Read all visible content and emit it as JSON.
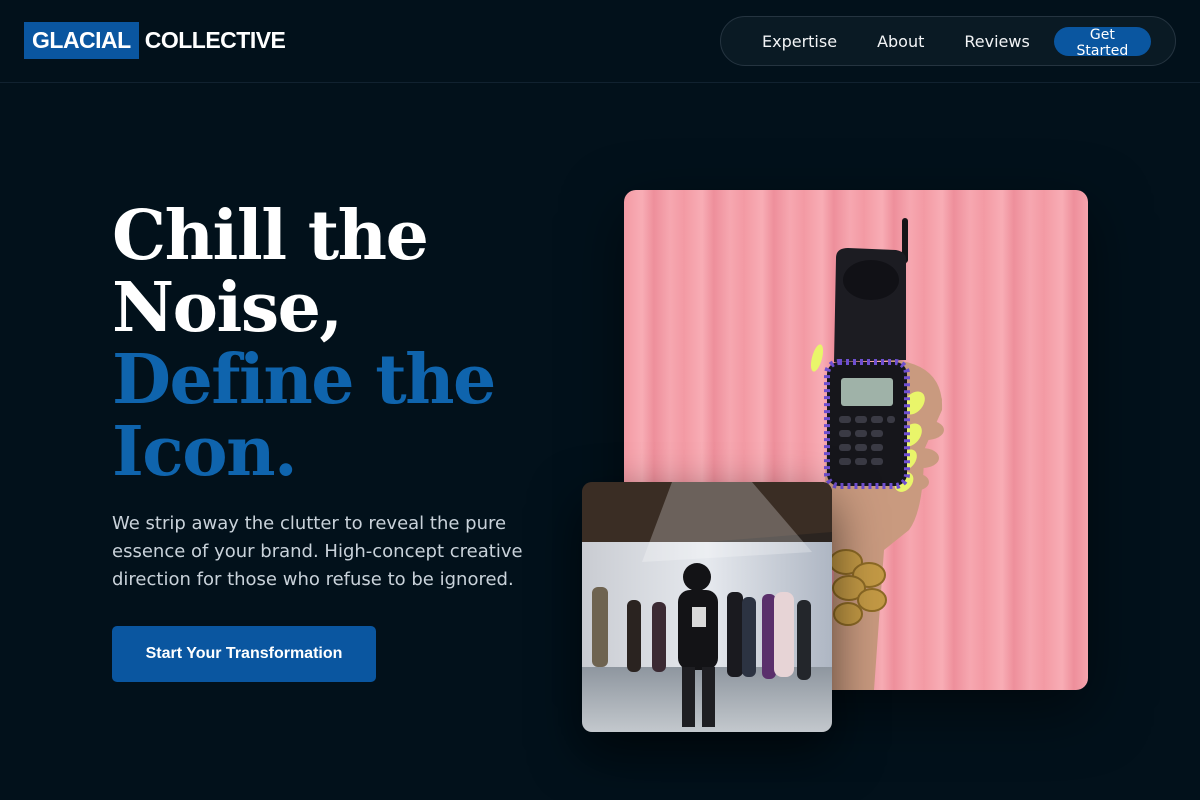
{
  "brand": {
    "highlight": "GLACIAL",
    "rest": "COLLECTIVE"
  },
  "nav": {
    "links": [
      "Expertise",
      "About",
      "Reviews"
    ],
    "cta": "Get Started"
  },
  "hero": {
    "title_lines": [
      "Chill the",
      "Noise,",
      "Define the",
      "Icon."
    ],
    "subtitle": "We strip away the clutter to reveal the pure essence of your brand. High-concept creative direction for those who refuse to be ignored.",
    "cta": "Start Your Transformation"
  },
  "colors": {
    "background": "#02111b",
    "accent": "#0a56a0",
    "accent_text": "#0f64ad"
  },
  "images": {
    "main": "hand-holding-flip-phone-photo",
    "secondary": "fashion-show-runway-photo"
  }
}
